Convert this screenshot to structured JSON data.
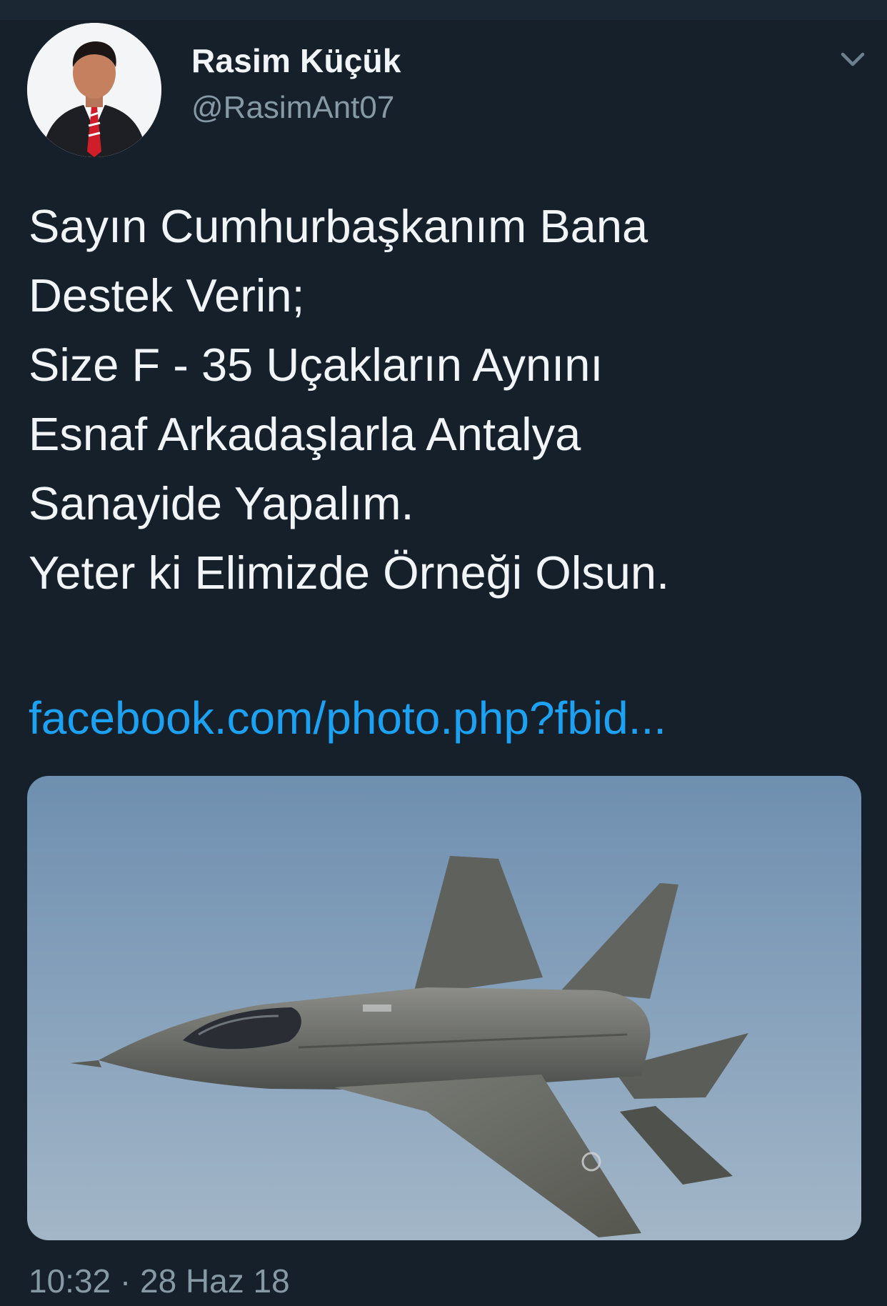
{
  "tweet": {
    "author": {
      "display_name": "Rasim Küçük",
      "handle": "@RasimAnt07"
    },
    "text_lines": [
      "Sayın Cumhurbaşkanım Bana",
      "Destek Verin;",
      "Size F - 35 Uçakların Aynını",
      "Esnaf Arkadaşlarla Antalya",
      "Sanayide Yapalım.",
      "Yeter ki Elimizde Örneği Olsun."
    ],
    "link_text": "facebook.com/photo.php?fbid...",
    "media": {
      "description_icon": "fighter-jet-photo"
    },
    "date": {
      "time": "10:32",
      "separator": "·",
      "day": "28 Haz 18"
    }
  },
  "colors": {
    "background": "#15202b",
    "text": "#f2f5f8",
    "secondary": "#8899a6",
    "link": "#1da1f2"
  },
  "icons": {
    "menu": "chevron-down-icon"
  }
}
